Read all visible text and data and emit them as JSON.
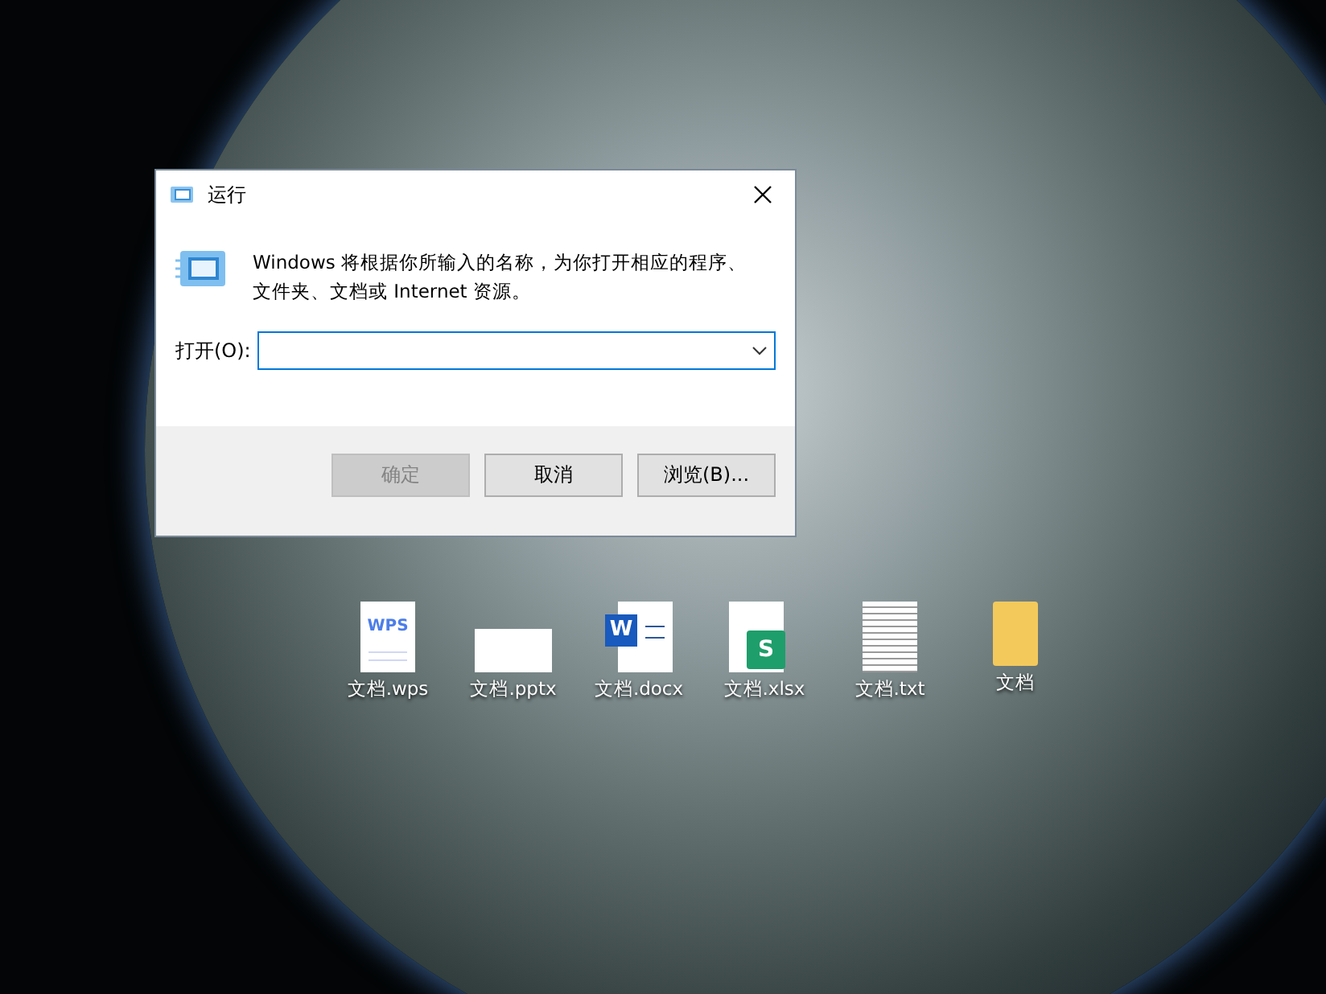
{
  "dialog": {
    "title": "运行",
    "message": "Windows 将根据你所输入的名称，为你打开相应的程序、文件夹、文档或 Internet 资源。",
    "open_label": "打开(O):",
    "buttons": [
      {
        "label": "确定",
        "disabled": true
      },
      {
        "label": "取消",
        "disabled": false
      },
      {
        "label": "浏览(B)...",
        "disabled": false
      }
    ]
  },
  "desktop_icons": [
    {
      "kind": "wps",
      "label": "文档.wps",
      "glyph": "WPS"
    },
    {
      "kind": "pptx",
      "label": "文档.pptx"
    },
    {
      "kind": "docx",
      "label": "文档.docx",
      "glyph": "W"
    },
    {
      "kind": "xlsx",
      "label": "文档.xlsx",
      "glyph": "S"
    },
    {
      "kind": "txt",
      "label": "文档.txt"
    },
    {
      "kind": "folder",
      "label": "文档"
    }
  ]
}
